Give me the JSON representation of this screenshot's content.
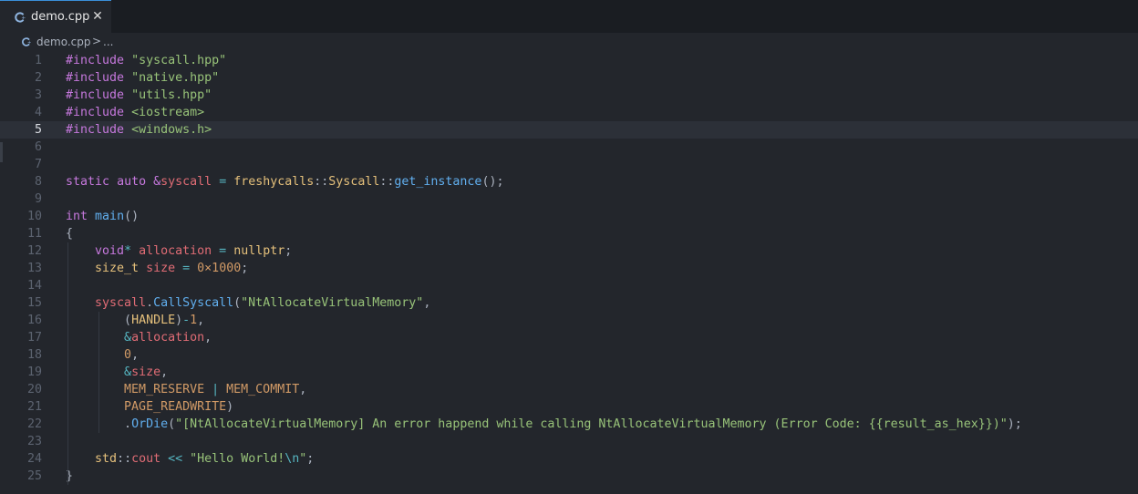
{
  "tab": {
    "title": "demo.cpp",
    "close_glyph": "✕",
    "icon": "cpp-file-icon"
  },
  "breadcrumb": {
    "file": "demo.cpp",
    "separator": ">",
    "more": "..."
  },
  "editor": {
    "current_line": 5,
    "lines": [
      {
        "n": "1",
        "tokens": [
          [
            "kw",
            "#include"
          ],
          [
            "pl",
            " "
          ],
          [
            "str",
            "\"syscall.hpp\""
          ]
        ]
      },
      {
        "n": "2",
        "tokens": [
          [
            "kw",
            "#include"
          ],
          [
            "pl",
            " "
          ],
          [
            "str",
            "\"native.hpp\""
          ]
        ]
      },
      {
        "n": "3",
        "tokens": [
          [
            "kw",
            "#include"
          ],
          [
            "pl",
            " "
          ],
          [
            "str",
            "\"utils.hpp\""
          ]
        ]
      },
      {
        "n": "4",
        "tokens": [
          [
            "kw",
            "#include"
          ],
          [
            "pl",
            " "
          ],
          [
            "str",
            "<iostream>"
          ]
        ]
      },
      {
        "n": "5",
        "tokens": [
          [
            "kw",
            "#include"
          ],
          [
            "pl",
            " "
          ],
          [
            "str",
            "<windows.h>"
          ]
        ]
      },
      {
        "n": "6",
        "tokens": []
      },
      {
        "n": "7",
        "tokens": []
      },
      {
        "n": "8",
        "tokens": [
          [
            "kw",
            "static"
          ],
          [
            "pl",
            " "
          ],
          [
            "kw",
            "auto"
          ],
          [
            "pl",
            " "
          ],
          [
            "kw",
            "&"
          ],
          [
            "var",
            "syscall"
          ],
          [
            "pl",
            " "
          ],
          [
            "op",
            "="
          ],
          [
            "pl",
            " "
          ],
          [
            "typ",
            "freshycalls"
          ],
          [
            "pl",
            "::"
          ],
          [
            "typ",
            "Syscall"
          ],
          [
            "pl",
            "::"
          ],
          [
            "fn",
            "get_instance"
          ],
          [
            "pl",
            "();"
          ]
        ]
      },
      {
        "n": "9",
        "tokens": []
      },
      {
        "n": "10",
        "tokens": [
          [
            "kw",
            "int"
          ],
          [
            "pl",
            " "
          ],
          [
            "fn",
            "main"
          ],
          [
            "pl",
            "()"
          ]
        ]
      },
      {
        "n": "11",
        "tokens": [
          [
            "pl",
            "{"
          ]
        ]
      },
      {
        "n": "12",
        "tokens": [
          [
            "pl",
            "    "
          ],
          [
            "kw",
            "void"
          ],
          [
            "op",
            "*"
          ],
          [
            "pl",
            " "
          ],
          [
            "var",
            "allocation"
          ],
          [
            "pl",
            " "
          ],
          [
            "op",
            "="
          ],
          [
            "pl",
            " "
          ],
          [
            "typ",
            "nullptr"
          ],
          [
            "pl",
            ";"
          ]
        ]
      },
      {
        "n": "13",
        "tokens": [
          [
            "pl",
            "    "
          ],
          [
            "typ",
            "size_t"
          ],
          [
            "pl",
            " "
          ],
          [
            "var",
            "size"
          ],
          [
            "pl",
            " "
          ],
          [
            "op",
            "="
          ],
          [
            "pl",
            " "
          ],
          [
            "num",
            "0×1000"
          ],
          [
            "pl",
            ";"
          ]
        ]
      },
      {
        "n": "14",
        "tokens": []
      },
      {
        "n": "15",
        "tokens": [
          [
            "pl",
            "    "
          ],
          [
            "var",
            "syscall"
          ],
          [
            "pl",
            "."
          ],
          [
            "fn",
            "CallSyscall"
          ],
          [
            "pl",
            "("
          ],
          [
            "str",
            "\"NtAllocateVirtualMemory\""
          ],
          [
            "pl",
            ","
          ]
        ]
      },
      {
        "n": "16",
        "tokens": [
          [
            "pl",
            "        ("
          ],
          [
            "typ",
            "HANDLE"
          ],
          [
            "pl",
            ")"
          ],
          [
            "op",
            "-"
          ],
          [
            "num",
            "1"
          ],
          [
            "pl",
            ","
          ]
        ]
      },
      {
        "n": "17",
        "tokens": [
          [
            "pl",
            "        "
          ],
          [
            "op",
            "&"
          ],
          [
            "var",
            "allocation"
          ],
          [
            "pl",
            ","
          ]
        ]
      },
      {
        "n": "18",
        "tokens": [
          [
            "pl",
            "        "
          ],
          [
            "num",
            "0"
          ],
          [
            "pl",
            ","
          ]
        ]
      },
      {
        "n": "19",
        "tokens": [
          [
            "pl",
            "        "
          ],
          [
            "op",
            "&"
          ],
          [
            "var",
            "size"
          ],
          [
            "pl",
            ","
          ]
        ]
      },
      {
        "n": "20",
        "tokens": [
          [
            "pl",
            "        "
          ],
          [
            "num",
            "MEM_RESERVE"
          ],
          [
            "pl",
            " "
          ],
          [
            "op",
            "|"
          ],
          [
            "pl",
            " "
          ],
          [
            "num",
            "MEM_COMMIT"
          ],
          [
            "pl",
            ","
          ]
        ]
      },
      {
        "n": "21",
        "tokens": [
          [
            "pl",
            "        "
          ],
          [
            "num",
            "PAGE_READWRITE"
          ],
          [
            "pl",
            ")"
          ]
        ]
      },
      {
        "n": "22",
        "tokens": [
          [
            "pl",
            "        ."
          ],
          [
            "fn",
            "OrDie"
          ],
          [
            "pl",
            "("
          ],
          [
            "str",
            "\"[NtAllocateVirtualMemory] An error happend while calling NtAllocateVirtualMemory (Error Code: {{result_as_hex}})\""
          ],
          [
            "pl",
            ");"
          ]
        ]
      },
      {
        "n": "23",
        "tokens": []
      },
      {
        "n": "24",
        "tokens": [
          [
            "pl",
            "    "
          ],
          [
            "typ",
            "std"
          ],
          [
            "pl",
            "::"
          ],
          [
            "var",
            "cout"
          ],
          [
            "pl",
            " "
          ],
          [
            "op",
            "<<"
          ],
          [
            "pl",
            " "
          ],
          [
            "str",
            "\"Hello World!"
          ],
          [
            "esc",
            "\\n"
          ],
          [
            "str",
            "\""
          ],
          [
            "pl",
            ";"
          ]
        ]
      },
      {
        "n": "25",
        "tokens": [
          [
            "pl",
            "}"
          ]
        ]
      }
    ]
  },
  "colors": {
    "background": "#23262c",
    "tab_accent": "#3a8fd9",
    "keyword": "#c678dd",
    "string": "#98c379",
    "function": "#61afef",
    "variable": "#e06c75",
    "type": "#e5c07b",
    "number": "#d19a66"
  }
}
